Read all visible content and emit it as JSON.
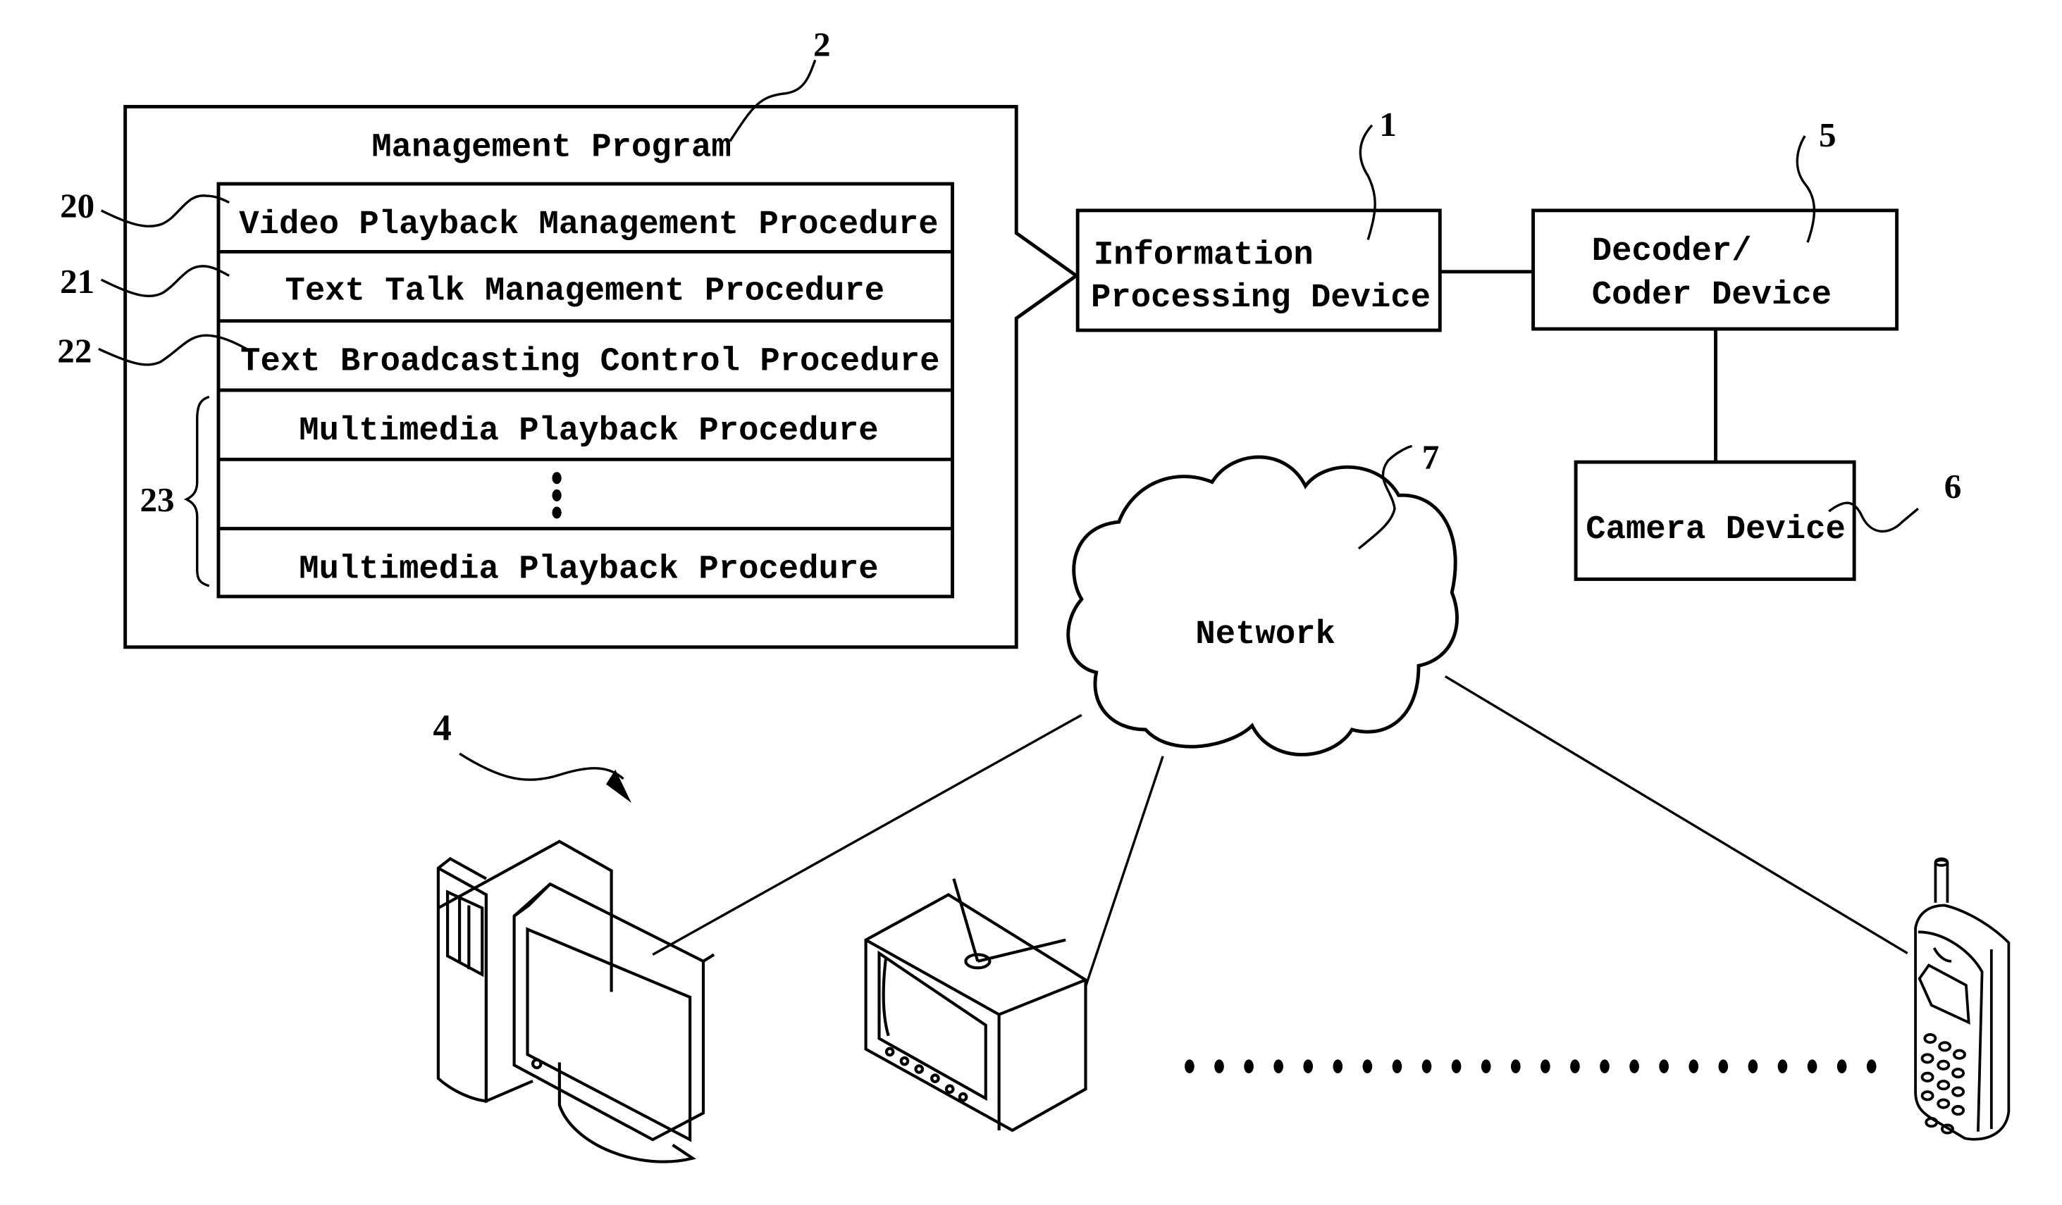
{
  "diagram": {
    "management_program": {
      "title": "Management Program",
      "ref": "2",
      "procedures": [
        {
          "ref": "20",
          "label": "Video Playback Management Procedure"
        },
        {
          "ref": "21",
          "label": "Text Talk Management Procedure"
        },
        {
          "ref": "22",
          "label": "Text Broadcasting Control Procedure"
        },
        {
          "ref": "23",
          "label": "Multimedia Playback Procedure"
        },
        {
          "ref": "23",
          "label": "⋮"
        },
        {
          "ref": "23",
          "label": "Multimedia Playback Procedure"
        }
      ],
      "group_ref": "23"
    },
    "info_device": {
      "ref": "1",
      "line1": "Information",
      "line2": "Processing Device"
    },
    "decoder": {
      "ref": "5",
      "line1": "Decoder/",
      "line2": "Coder Device"
    },
    "camera": {
      "ref": "6",
      "label": "Camera Device"
    },
    "network": {
      "ref": "7",
      "label": "Network"
    },
    "clients": {
      "ref": "4",
      "items": [
        "computer-icon",
        "television-icon",
        "mobile-phone-icon"
      ],
      "ellipsis_dots": 24
    }
  }
}
